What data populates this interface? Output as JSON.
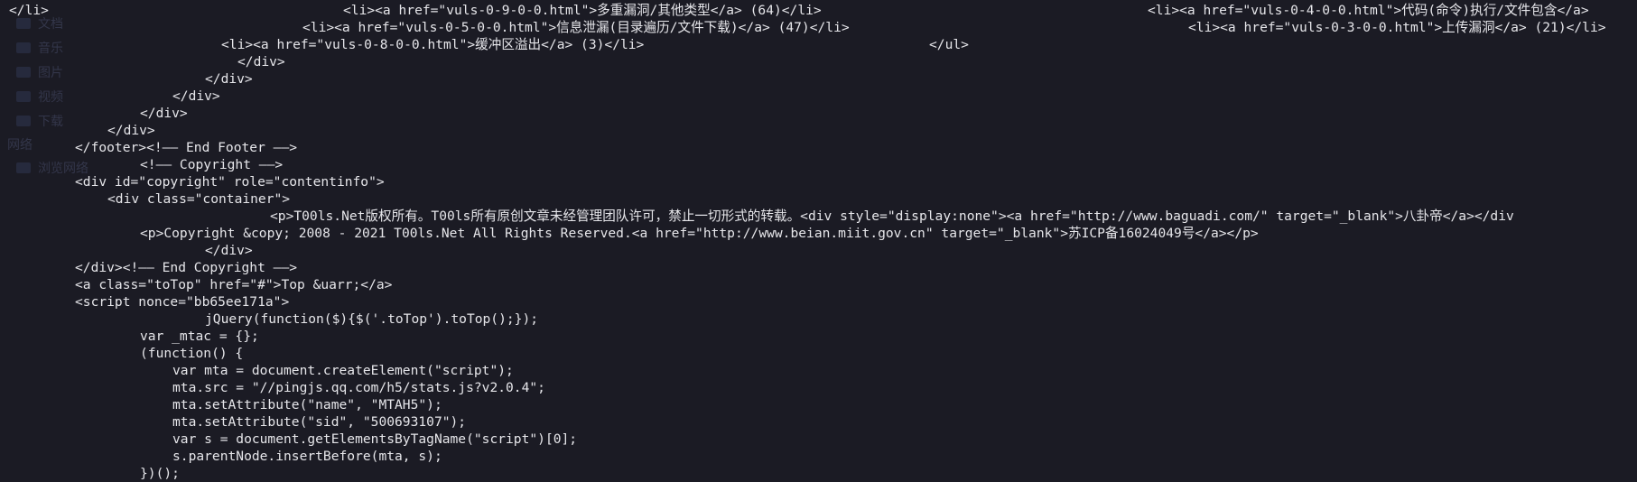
{
  "sidebar": {
    "items": [
      "文档",
      "音乐",
      "图片",
      "视频",
      "下载"
    ],
    "section_label": "网络",
    "device_label": "浏览网络"
  },
  "terminal": {
    "lines": [
      "</li>",
      "<li><a href=\"vuls-0-9-0-0.html\">多重漏洞/其他类型</a> (64)</li>",
      "<li><a href=\"vuls-0-4-0-0.html\">代码(命令)执行/文件包含</a>",
      "<li><a href=\"vuls-0-5-0-0.html\">信息泄漏(目录遍历/文件下载)</a> (47)</li>",
      "<li><a href=\"vuls-0-3-0-0.html\">上传漏洞</a> (21)</li>",
      "<li><a href=\"vuls-0-8-0-0.html\">缓冲区溢出</a> (3)</li>",
      "</ul>",
      "</div>",
      "</div>",
      "</div>",
      "</div>",
      "</div>",
      "</footer><!—— End Footer ——>",
      "<!—— Copyright ——>",
      "<div id=\"copyright\" role=\"contentinfo\">",
      "<div class=\"container\">",
      "<p>T00ls.Net版权所有。T00ls所有原创文章未经管理团队许可，禁止一切形式的转载。<div style=\"display:none\"><a href=\"http://www.baguadi.com/\" target=\"_blank\">八卦帝</a></div",
      "<p>Copyright &copy; 2008 - 2021 T00ls.Net All Rights Reserved.<a href=\"http://www.beian.miit.gov.cn\" target=\"_blank\">苏ICP备16024049号</a></p>",
      "</div>",
      "</div><!—— End Copyright ——>",
      "<a class=\"toTop\" href=\"#\">Top &uarr;</a>",
      "<script nonce=\"bb65ee171a\">",
      "jQuery(function($){$('.toTop').toTop();});",
      "var _mtac = {};",
      "(function() {",
      "var mta = document.createElement(\"script\");",
      "mta.src = \"//pingjs.qq.com/h5/stats.js?v2.0.4\";",
      "mta.setAttribute(\"name\", \"MTAH5\");",
      "mta.setAttribute(\"sid\", \"500693107\");",
      "var s = document.getElementsByTagName(\"script\")[0];",
      "s.parentNode.insertBefore(mta, s);",
      "})();"
    ]
  },
  "colors": {
    "background": "#1b1b24",
    "foreground": "#e6e6ea"
  }
}
